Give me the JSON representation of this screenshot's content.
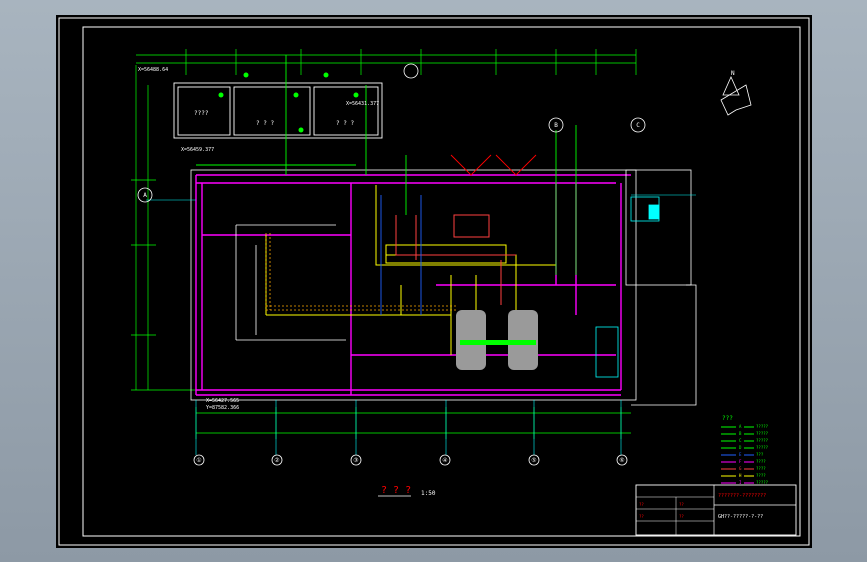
{
  "drawing": {
    "room_label": "? ? ?",
    "scale_label": "1:50",
    "room_labels": {
      "tank_room_a": "????",
      "tank_room_b": "? ? ?",
      "tank_room_c": "? ? ?"
    },
    "coordinates": {
      "top_left": "X=56488.64",
      "mid_top": "X=56431.377",
      "left_top": "X=56459.377",
      "bottom_left_x": "X=56427.565",
      "bottom_left_y": "Y=87582.366"
    },
    "axis_labels": [
      "①",
      "②",
      "③",
      "④",
      "⑤",
      "⑥"
    ],
    "row_labels": [
      "A",
      "B",
      "C"
    ],
    "north_symbol": "N"
  },
  "legend": {
    "title": "???",
    "items": [
      {
        "code": "A",
        "color": "#00ff00",
        "text": "?????"
      },
      {
        "code": "B",
        "color": "#00ff00",
        "text": "?????"
      },
      {
        "code": "C",
        "color": "#00ff00",
        "text": "?????"
      },
      {
        "code": "D",
        "color": "#00ff00",
        "text": "?????"
      },
      {
        "code": "E",
        "color": "#2060ff",
        "text": "???"
      },
      {
        "code": "F",
        "color": "#ff00ff",
        "text": "????"
      },
      {
        "code": "G",
        "color": "#ff4040",
        "text": "????"
      },
      {
        "code": "H",
        "color": "#ffff00",
        "text": "????"
      },
      {
        "code": "I",
        "color": "#ff00ff",
        "text": "?????"
      }
    ]
  },
  "title_block": {
    "title": "???????-????????",
    "drawing_no": "GH??-?????-?-??",
    "rows": [
      "??",
      "??",
      "??",
      "??"
    ]
  },
  "colors": {
    "wall": "#ff00ff",
    "dimension": "#00ff00",
    "outline": "#ffffff",
    "pipe": "#ffff00",
    "axis": "#00ffff",
    "tank": "#9a9a9a"
  }
}
